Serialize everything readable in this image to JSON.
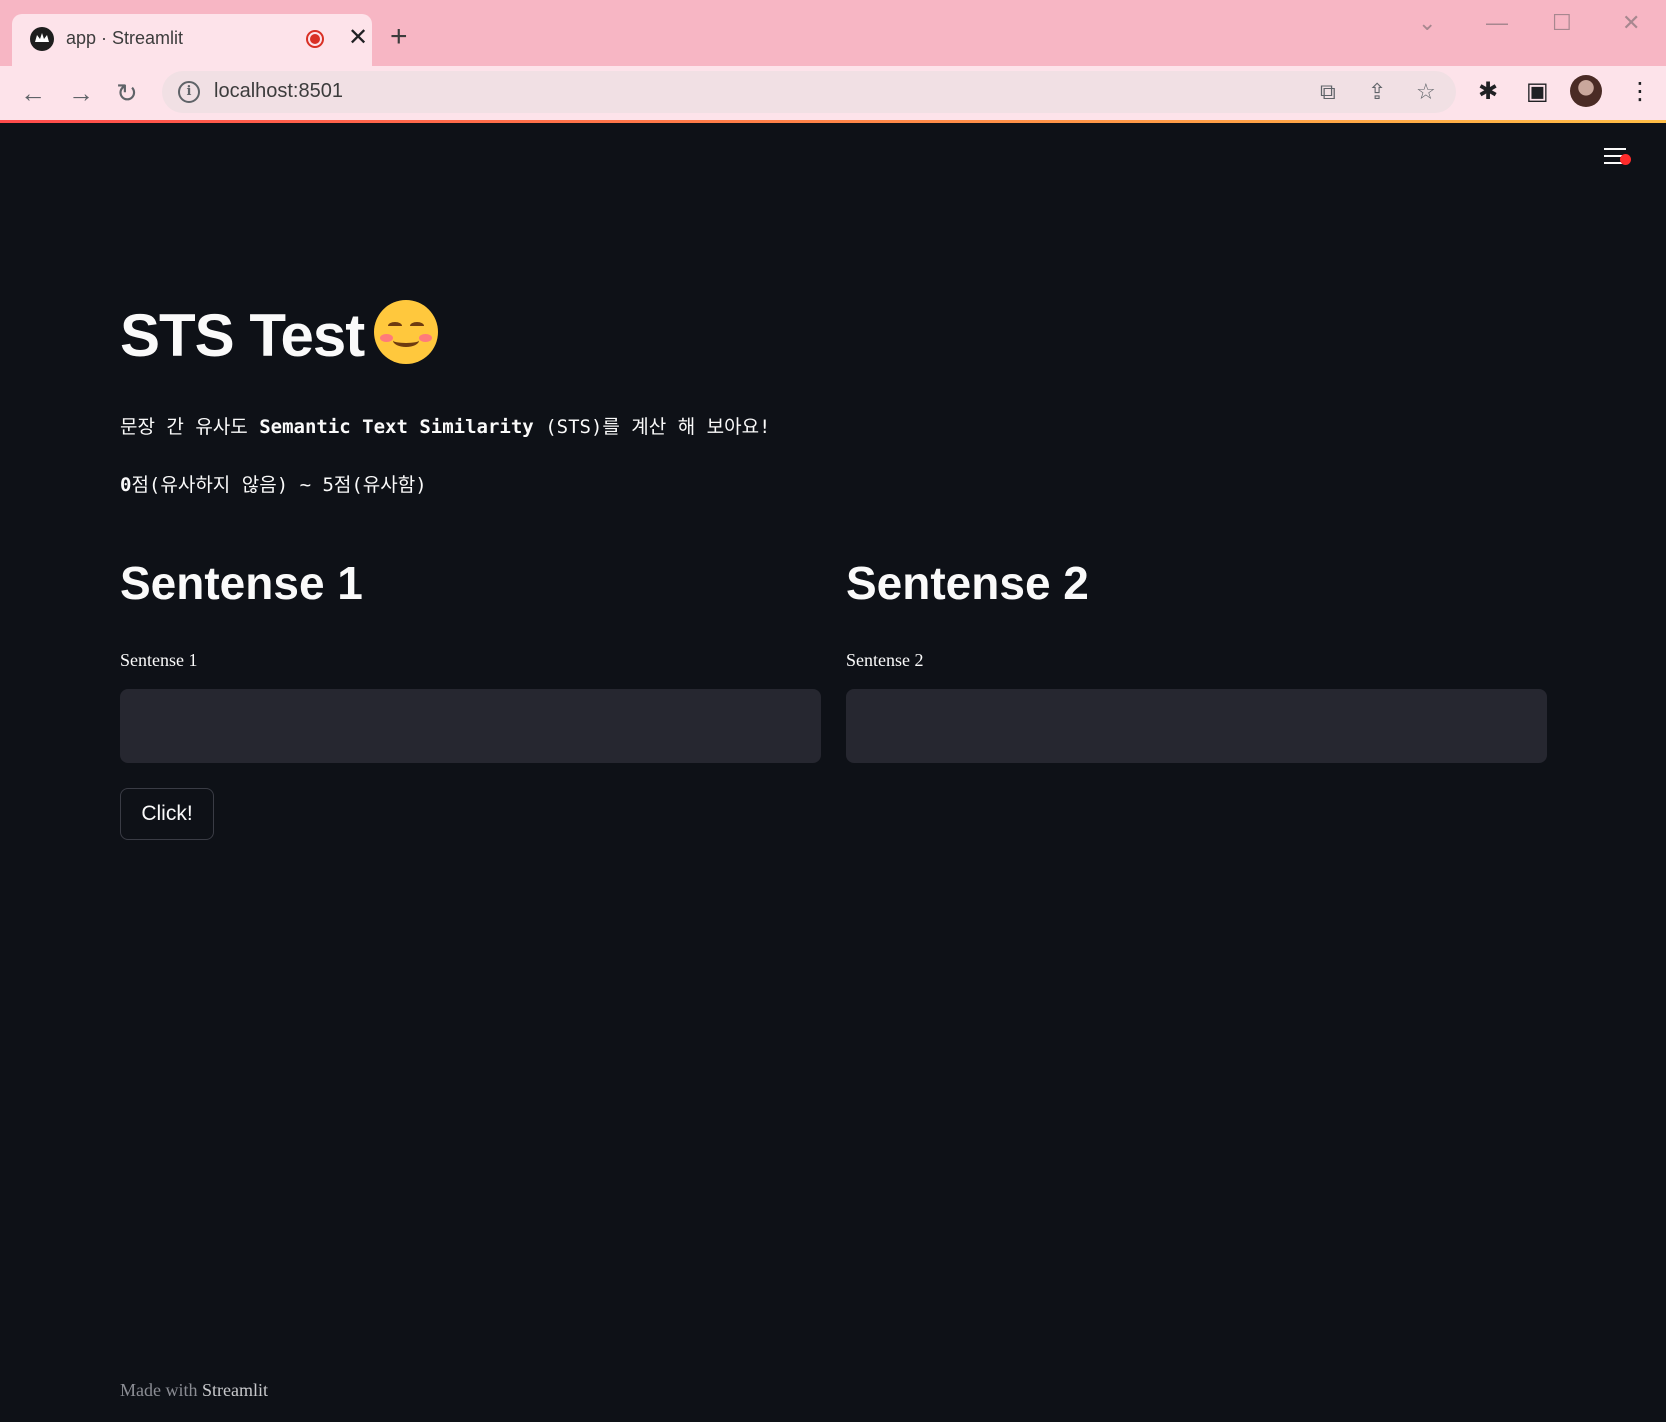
{
  "browser": {
    "tab_title": "app · Streamlit",
    "tab_close": "✕",
    "new_tab": "+",
    "url": "localhost:8501",
    "window_controls": [
      "⌄",
      "—",
      "☐",
      "✕"
    ],
    "nav_icons": {
      "back": "←",
      "forward": "→",
      "reload": "↻"
    },
    "toolbar_icons": {
      "translate": "⧉",
      "share": "⇪",
      "bookmark": "☆",
      "extensions": "✱",
      "sidebar": "▣",
      "menu": "⋮"
    }
  },
  "app": {
    "title": "STS Test",
    "description_lines": [
      {
        "prefix": "문장 간 유사도 ",
        "bold": "Semantic Text Similarity",
        "suffix": " (STS)를 계산 해 보아요!"
      },
      {
        "prefix": "",
        "bold": "0",
        "suffix": "점(유사하지 않음) ~ 5점(유사함)"
      }
    ],
    "columns": [
      {
        "heading": "Sentense 1",
        "label": "Sentense 1",
        "value": ""
      },
      {
        "heading": "Sentense 2",
        "label": "Sentense 2",
        "value": ""
      }
    ],
    "button_label": "Click!",
    "footer": {
      "made_with": "Made with ",
      "brand": "Streamlit"
    }
  },
  "colors": {
    "background": "#0e1117",
    "input_bg": "#262730",
    "text": "#fafafa",
    "accent": "#ff4b4b",
    "chrome_tabbar": "#f7b6c4",
    "chrome_toolbar": "#fde3ea"
  }
}
